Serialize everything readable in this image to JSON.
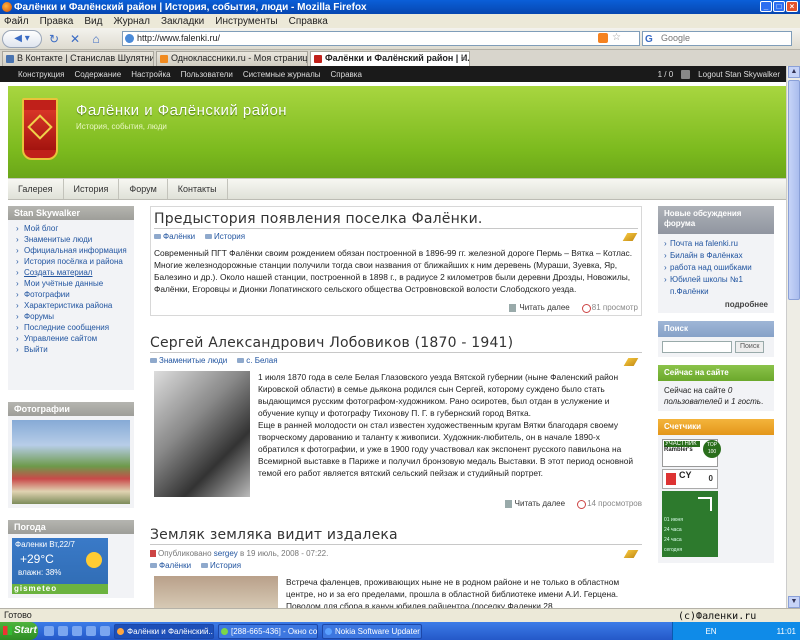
{
  "window": {
    "title": "Фалёнки и Фалёнский район | История, события, люди - Mozilla Firefox",
    "controls": [
      "_",
      "□",
      "×"
    ]
  },
  "menu": [
    "Файл",
    "Правка",
    "Вид",
    "Журнал",
    "Закладки",
    "Инструменты",
    "Справка"
  ],
  "nav": {
    "url": "http://www.falenki.ru/",
    "search_placeholder": "Google",
    "search_engine": "G"
  },
  "tabs": [
    {
      "label": "В Контакте | Станислав Шулятников"
    },
    {
      "label": "Одноклассники.ru - Моя страница"
    },
    {
      "label": "Фалёнки и Фалёнский район | И...",
      "active": true
    }
  ],
  "admin": {
    "links": [
      "Конструкция",
      "Содержание",
      "Настройка",
      "Пользователи",
      "Системные журналы",
      "Справка"
    ],
    "counter": "1 / 0",
    "logout": "Logout Stan Skywalker"
  },
  "site": {
    "title": "Фалёнки и Фалёнский район",
    "slogan": "История, события, люди",
    "primary_nav": [
      "Галерея",
      "История",
      "Форум",
      "Контакты"
    ]
  },
  "left": {
    "user_block_title": "Stan Skywalker",
    "user_menu": [
      "Мой блог",
      "Знаменитые люди",
      "Официальная информация",
      "История посёлка и района",
      "Создать материал",
      "Мои учётные данные",
      "Фотографии",
      "Характеристика района",
      "Форумы",
      "Последние сообщения",
      "Управление сайтом",
      "Выйти"
    ],
    "photos_title": "Фотографии",
    "weather_title": "Погода",
    "weather": {
      "city": "Фаленки Вт,22/7",
      "temp": "+29°C",
      "humidity": "влажн: 38%",
      "brand": "gismeteo"
    }
  },
  "nodes": [
    {
      "title": "Предыстория появления поселка Фалёнки.",
      "terms": [
        "Фалёнки",
        "История"
      ],
      "body": "Современный ПГТ Фалёнки своим рождением обязан построенной в 1896-99 гг. железной дороге Пермь – Вятка – Котлас. Многие железнодорожные станции получили тогда свои названия от ближайших к ним деревень (Мураши, Зуевка, Яр, Балезино и др.). Около нашей станции, построенной в 1898 г., в радиусе 2 километров были деревни Дрозды, Новожилы, Фалёнки, Егоровцы и Дионки Лопатинского сельского общества Островновской волости Слободского уезда.",
      "read_more": "Читать далее",
      "views": "81 просмотр"
    },
    {
      "title": "Сергей Александрович Лобовиков (1870 - 1941)",
      "terms": [
        "Знаменитые люди",
        "с. Белая"
      ],
      "body": "1 июля 1870 года в селе Белая Глазовского уезда Вятской губернии (ныне Фаленский район Кировской области) в семье дьякона родился сын Сергей, которому суждено было стать выдающимся русским фотографом-художником. Рано осиротев, был отдан в услужение и обучение купцу и фотографу Тихонову П. Г. в губернский город Вятка.\nЕще в ранней молодости он стал известен художественным кругам Вятки благодаря своему творческому дарованию и таланту к живописи. Художник-любитель, он в начале 1890-х обратился к фотографии, и уже в 1900 году участвовал как экспонент русского павильона на Всемирной выставке в Париже и получил бронзовую медаль Выставки. В этот период основной темой его работ является вятский сельский пейзаж и студийный портрет.",
      "read_more": "Читать далее",
      "views": "14 просмотров"
    },
    {
      "title": "Земляк земляка видит издалека",
      "meta_prefix": "Опубликовано",
      "author": "sergey",
      "meta_suffix": "в 19 июль, 2008 - 07:22.",
      "terms": [
        "Фалёнки",
        "История"
      ],
      "body": "Встреча фаленцев, проживающих ныне не в родном районе и не только в областном центре, но и за его пределами, прошла в областной библиотеке имени А.И. Герцена. Поводом для сбора в канун юбилея райцентра (поселку Фаленки 28"
    }
  ],
  "right": {
    "discussions_title": "Новые обсуждения форума",
    "discussions": [
      "Почта на falenki.ru",
      "Билайн в Фалёнках",
      "работа над ошибками",
      "Юбилей школы №1 п.Фалёнки"
    ],
    "more": "подробнее",
    "search_title": "Поиск",
    "search_button": "Поиск",
    "online_title": "Сейчас на сайте",
    "online_text_1": "Сейчас на сайте",
    "online_count_users": "0 пользователей",
    "online_text_2": "и",
    "online_count_guests": "1 гость",
    "counters_title": "Счетчики",
    "rambler": {
      "top": "УЧАСТНИК",
      "name": "Rambler's",
      "badge": "TOP 100"
    },
    "cy": {
      "label": "CY",
      "value": "0"
    },
    "li_rows": [
      "01 июня",
      "24 часа",
      "24 часа",
      "сегодня"
    ]
  },
  "status": {
    "text": "Готово",
    "copyright": "(c)Фаленки.ru"
  },
  "taskbar": {
    "start": "Start",
    "tasks": [
      "Фалёнки и Фалёнский...",
      "[288-665-436] - Окно со...",
      "Nokia Software Updater"
    ],
    "clock": "11:01",
    "lang": "EN"
  }
}
